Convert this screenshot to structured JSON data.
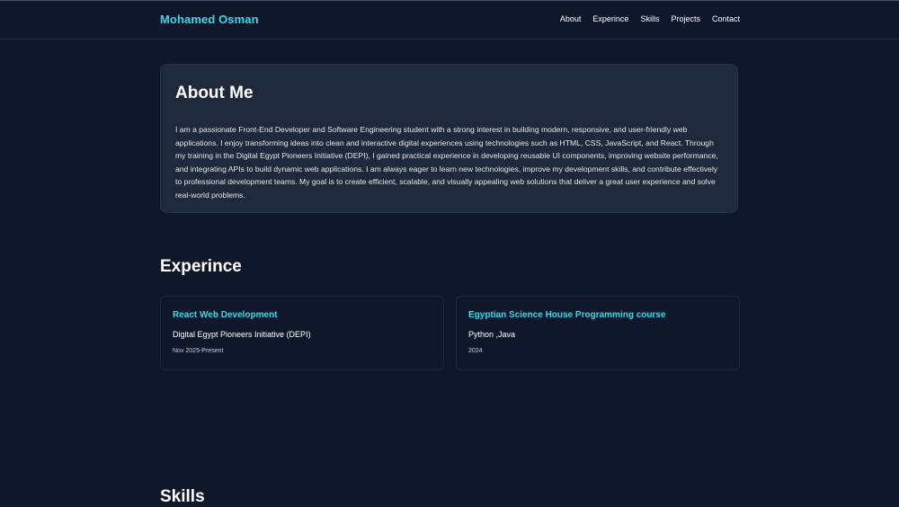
{
  "header": {
    "brand": "Mohamed Osman",
    "nav": [
      "About",
      "Experince",
      "Skills",
      "Projects",
      "Contact"
    ]
  },
  "about": {
    "title": "About Me",
    "text": "I am a passionate Front-End Developer and Software Engineering student with a strong interest in building modern, responsive, and user-friendly web applications. I enjoy transforming ideas into clean and interactive digital experiences using technologies such as HTML, CSS, JavaScript, and React. Through my training in the Digital Egypt Pioneers Initiative (DEPI), I gained practical experience in developing reusable UI components, improving website performance, and integrating APIs to build dynamic web applications. I am always eager to learn new technologies, improve my development skills, and contribute effectively to professional development teams. My goal is to create efficient, scalable, and visually appealing web solutions that deliver a great user experience and solve real-world problems."
  },
  "experience": {
    "title": "Experince",
    "items": [
      {
        "role": "React Web Development",
        "org": "Digital Egypt Pioneers Initiative (DEPI)",
        "date": "Nov 2025-Present"
      },
      {
        "role": "Egyptian Science House Programming course",
        "org": "Python ,Java",
        "date": "2024"
      }
    ]
  },
  "skills": {
    "title": "Skills"
  },
  "colors": {
    "background": "#0f172a",
    "card": "#1e293b",
    "accent": "#38d9e9"
  }
}
